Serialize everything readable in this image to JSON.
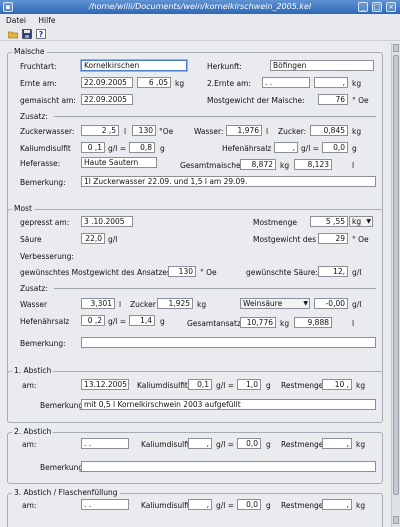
{
  "window": {
    "title": "/home/willi/Documents/wein/kornelkirschwein_2005.kel"
  },
  "menu": [
    "Datei",
    "Hilfe"
  ],
  "maische": {
    "legend": "Maische",
    "fruchtart_label": "Fruchtart:",
    "fruchtart": "Kornelkirschen",
    "herkunft_label": "Herkunft:",
    "herkunft": "Böfingen",
    "ernte_label": "Ernte am:",
    "ernte": "22.09.2005",
    "ernte_kg": "6 ,05",
    "kg": "kg",
    "ernte2_label": "2.Ernte am:",
    "ernte2": ". .",
    "ernte2_kg": ",",
    "gemaischt_label": "gemaischt am:",
    "gemaischt": "22.09.2005",
    "mostgewicht_label": "Mostgewicht der Maische:",
    "mostgewicht": "76",
    "oe": "° Oe",
    "zusatz_label": "Zusatz:",
    "zuckerwasser_label": "Zuckerwasser:",
    "zuckerwasser": "2 ,5",
    "l": "l",
    "zuckerwasser_oe": "130",
    "zuckerwasser_oe_unit": "°Oe",
    "wasser_label": "Wasser:",
    "wasser": "1,976",
    "zucker_label": "Zucker:",
    "zucker": "0,845",
    "kalium_label": "Kaliumdisulfit",
    "kalium": "0 ,1",
    "gl": "g/l =",
    "kalium_g": "0,8",
    "g": "g",
    "hefenaehr_label": "Hefenährsalz",
    "hefenaehr": ",",
    "hefenaehr_g": "0,0",
    "heferasse_label": "Heferasse:",
    "heferasse": "Haute Sautern",
    "gesamt_label": "Gesamtmaische:",
    "gesamt_kg": "8,872",
    "gesamt_l": "8,123",
    "bemerkung_label": "Bemerkung:",
    "bemerkung": "1l Zuckerwasser 22.09. und 1,5 l am 29.09."
  },
  "most": {
    "legend": "Most",
    "gepresst_label": "gepresst am:",
    "gepresst": "3 .10.2005",
    "mostmenge_label": "Mostmenge",
    "mostmenge": "5 ,55",
    "mostmenge_unit": "kg",
    "saeure_label": "Säure",
    "saeure": "22,0",
    "gl_unit": "g/l",
    "mostgewicht_label": "Mostgewicht des Mosts:",
    "mostgewicht": "29",
    "oe": "° Oe",
    "verbesserung_label": "Verbesserung:",
    "gew_mostgewicht_label": "gewünschtes Mostgewicht des Ansatzes:",
    "gew_mostgewicht": "130",
    "gew_saeure_label": "gewünschte Säure:",
    "gew_saeure": "12,",
    "zusatz_label": "Zusatz:",
    "wasser_label": "Wasser",
    "wasser": "3,301",
    "l": "l",
    "zucker_label": "Zucker",
    "zucker": "1,925",
    "kg": "kg",
    "saeure_select": "Weinsäure",
    "saeure_val": "-0,00",
    "hefenaehr_label": "Hefenährsalz",
    "hefenaehr": "0 ,2",
    "gl": "g/l =",
    "hefenaehr_g": "1,4",
    "g": "g",
    "gesamt_label": "Gesamtansatz:",
    "gesamt_kg": "10,776",
    "gesamt_l": "9,888",
    "bemerkung_label": "Bemerkung:",
    "bemerkung": ""
  },
  "abstich1": {
    "legend": "1. Abstich",
    "am_label": "am:",
    "am": "13.12.2005",
    "kalium_label": "Kaliumdisulfit",
    "kalium": "0,1",
    "gl": "g/l =",
    "kalium_g": "1,0",
    "g": "g",
    "rest_label": "Restmenge:",
    "rest": "10 ,",
    "kg": "kg",
    "bemerkung_label": "Bemerkung:",
    "bemerkung": "mit 0,5 l  Kornelkirschwein 2003 aufgefüllt"
  },
  "abstich2": {
    "legend": "2. Abstich",
    "am_label": "am:",
    "am": ". .",
    "kalium_label": "Kaliumdisulfit",
    "kalium": ",",
    "gl": "g/l =",
    "kalium_g": "0,0",
    "g": "g",
    "rest_label": "Restmenge:",
    "rest": ",",
    "kg": "kg",
    "bemerkung_label": "Bemerkung:",
    "bemerkung": ""
  },
  "abstich3": {
    "legend": "3. Abstich / Flaschenfüllung",
    "am_label": "am:",
    "am": ". .",
    "kalium_label": "Kaliumdisulfit",
    "kalium": ",",
    "gl": "g/l =",
    "kalium_g": "0,0",
    "g": "g",
    "rest_label": "Restmenge:",
    "rest": ",",
    "kg": "kg"
  }
}
